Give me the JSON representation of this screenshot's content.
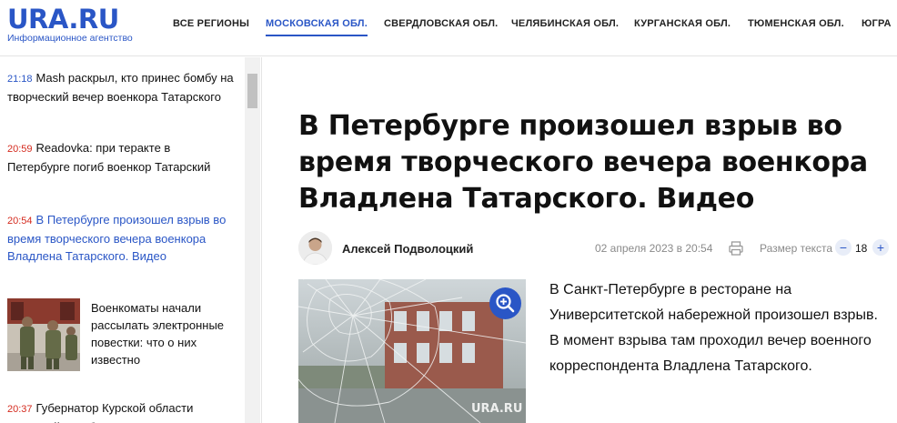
{
  "header": {
    "logo": "URA.RU",
    "logo_subtitle": "Информационное агентство",
    "nav": [
      {
        "label": "ВСЕ РЕГИОНЫ",
        "active": false
      },
      {
        "label": "МОСКОВСКАЯ ОБЛ.",
        "active": true
      },
      {
        "label": "СВЕРДЛОВСКАЯ ОБЛ.",
        "active": false
      },
      {
        "label": "ЧЕЛЯБИНСКАЯ ОБЛ.",
        "active": false
      },
      {
        "label": "КУРГАНСКАЯ ОБЛ.",
        "active": false
      },
      {
        "label": "ТЮМЕНСКАЯ ОБЛ.",
        "active": false
      },
      {
        "label": "ЮГРА",
        "active": false
      }
    ]
  },
  "sidebar": {
    "items": [
      {
        "time": "21:18",
        "headline": "Mash раскрыл, кто принес бомбу на творческий вечер военкора Татарского",
        "time_color": "blue"
      },
      {
        "time": "20:59",
        "headline": "Readovka: при теракте в Петербурге погиб военкор Татарский",
        "time_color": "red"
      },
      {
        "time": "20:54",
        "headline": "В Петербурге произошел взрыв во время творческого вечера военкора Владлена Татарского. Видео",
        "time_color": "red",
        "current": true
      },
      {
        "time": "",
        "headline": "Военкоматы начали рассылать электронные повестки: что о них известно",
        "has_photo": true
      },
      {
        "time": "20:37",
        "headline": "Губернатор Курской области Старовойт пообещал ВСУ",
        "time_color": "red"
      }
    ]
  },
  "article": {
    "title": "В Петербурге произошел взрыв во время творческого вечера военкора Владлена Татарского. Видео",
    "author": "Алексей Подволоцкий",
    "date": "02 апреля 2023 в 20:54",
    "text_size_label": "Размер текста",
    "text_size_value": "18",
    "minus_label": "−",
    "plus_label": "+",
    "image_watermark": "URA.RU",
    "lead": "В Санкт-Петербурге в ресторане на Университетской набережной произошел взрыв. В момент взрыва там проходил вечер военного корреспондента Владлена Татарского."
  },
  "colors": {
    "brand": "#2a56c6",
    "time_red": "#d42a1e"
  },
  "icons": [
    "print-icon",
    "zoom-in-icon"
  ]
}
